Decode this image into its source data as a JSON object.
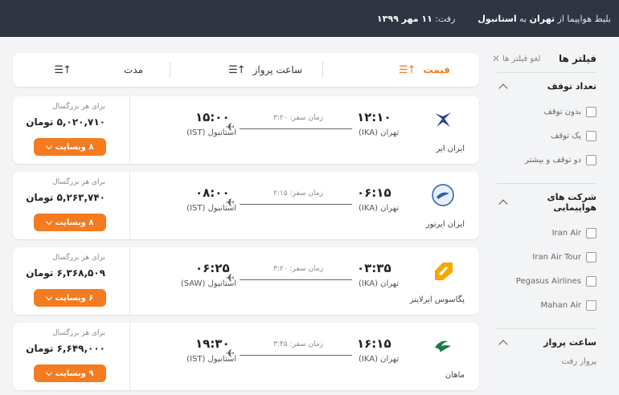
{
  "header": {
    "route_prefix": "بلیط هواپیما از",
    "origin": "تهران",
    "to_word": "به",
    "destination": "استانبول",
    "date_label": "رفت:",
    "date_value": "۱۱ مهر ۱۳۹۹"
  },
  "sidebar": {
    "title": "فیلتر ها",
    "clear_label": "لغو فیلتر ها",
    "stops": {
      "title": "تعداد توقف",
      "options": [
        "بدون توقف",
        "یک توقف",
        "دو توقف و بیشتر"
      ]
    },
    "airlines": {
      "title": "شرکت های هواپیمایی",
      "options": [
        "Iran Air",
        "Iran Air Tour",
        "Pegasus Airlines",
        "Mahan Air"
      ]
    },
    "flight_time": {
      "title": "ساعت پرواز",
      "subtitle": "پرواز رفت"
    }
  },
  "sortbar": {
    "price": "قیمت",
    "time": "ساعت پرواز",
    "duration": "مدت"
  },
  "flights": [
    {
      "airline": "ایران ایر",
      "dep_time": "۱۲:۱۰",
      "dep_city": "تهران (IKA)",
      "arr_time": "۱۵:۰۰",
      "arr_city": "استانبول (IST)",
      "duration": "زمان سفر: ۳:۲۰",
      "per_adult": "برای هر بزرگسال",
      "price": "۵,۰۲۰,۷۱۰ تومان",
      "btn": "۸ وبسایت",
      "logo_color": "#2a3f9a"
    },
    {
      "airline": "ایران ایرتور",
      "dep_time": "۰۶:۱۵",
      "dep_city": "تهران (IKA)",
      "arr_time": "۰۸:۰۰",
      "arr_city": "استانبول (IST)",
      "duration": "زمان سفر: ۲:۱۵",
      "per_adult": "برای هر بزرگسال",
      "price": "۵,۲۶۳,۷۴۰ تومان",
      "btn": "۸ وبسایت",
      "logo_color": "#2a5db0"
    },
    {
      "airline": "پگاسوس ایرلاینز",
      "dep_time": "۰۳:۳۵",
      "dep_city": "تهران (IKA)",
      "arr_time": "۰۶:۲۵",
      "arr_city": "استانبول (SAW)",
      "duration": "زمان سفر: ۳:۲۰",
      "per_adult": "برای هر بزرگسال",
      "price": "۶,۳۶۸,۵۰۹ تومان",
      "btn": "۶ وبسایت",
      "logo_color": "#f5a800"
    },
    {
      "airline": "ماهان",
      "dep_time": "۱۶:۱۵",
      "dep_city": "تهران (IKA)",
      "arr_time": "۱۹:۳۰",
      "arr_city": "استانبول (IST)",
      "duration": "زمان سفر: ۳:۴۵",
      "per_adult": "برای هر بزرگسال",
      "price": "۶,۶۴۹,۰۰۰ تومان",
      "btn": "۹ وبسایت",
      "logo_color": "#1f7a4a"
    }
  ],
  "colors": {
    "accent": "#f47b20",
    "header_bg": "#2f3542"
  }
}
